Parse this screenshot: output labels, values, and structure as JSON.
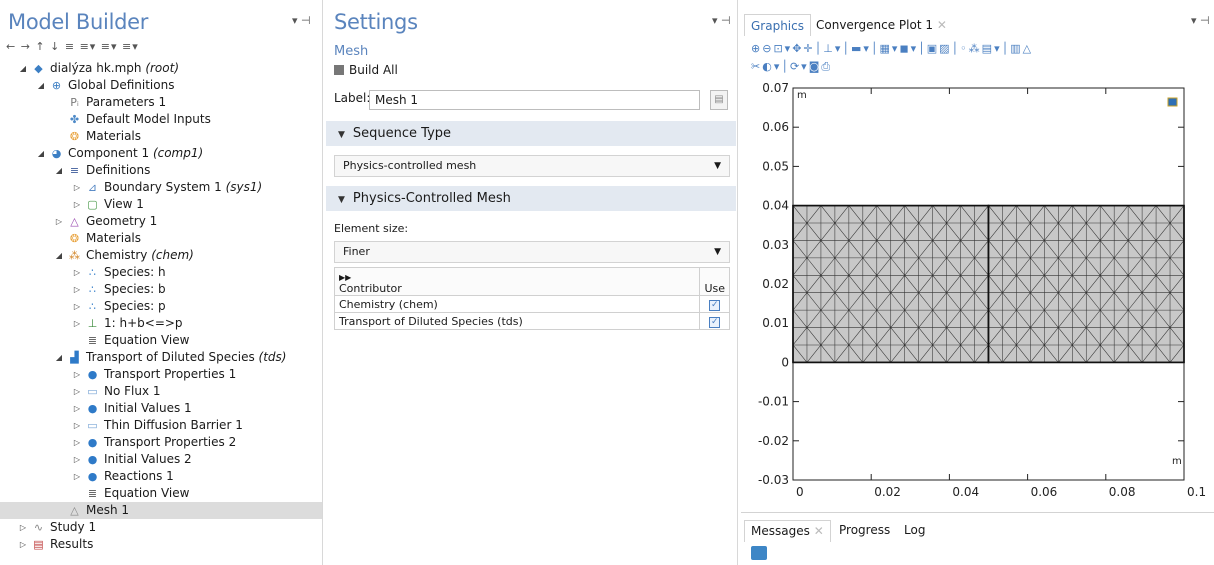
{
  "model_builder": {
    "title": "Model Builder",
    "toolbar": "← → ↑ ↓ ≡ ≡▾ ≡▾ ≡▾",
    "tree": [
      {
        "text": "dialýza hk.mph",
        "suffix": "(root)",
        "icon": "root-icon",
        "depth": 0,
        "exp": "◢"
      },
      {
        "text": "Global Definitions",
        "suffix": "",
        "icon": "globe-icon",
        "depth": 1,
        "exp": "◢"
      },
      {
        "text": "Parameters 1",
        "suffix": "",
        "icon": "parameters-icon",
        "depth": 2,
        "exp": ""
      },
      {
        "text": "Default Model Inputs",
        "suffix": "",
        "icon": "model-inputs-icon",
        "depth": 2,
        "exp": ""
      },
      {
        "text": "Materials",
        "suffix": "",
        "icon": "materials-icon",
        "depth": 2,
        "exp": ""
      },
      {
        "text": "Component 1",
        "suffix": "(comp1)",
        "icon": "component-icon",
        "depth": 1,
        "exp": "◢"
      },
      {
        "text": "Definitions",
        "suffix": "",
        "icon": "definitions-icon",
        "depth": 2,
        "exp": "◢"
      },
      {
        "text": "Boundary System 1",
        "suffix": "(sys1)",
        "icon": "boundary-system-icon",
        "depth": 3,
        "exp": "▷"
      },
      {
        "text": "View 1",
        "suffix": "",
        "icon": "view-icon",
        "depth": 3,
        "exp": "▷"
      },
      {
        "text": "Geometry 1",
        "suffix": "",
        "icon": "geometry-icon",
        "depth": 2,
        "exp": "▷"
      },
      {
        "text": "Materials",
        "suffix": "",
        "icon": "materials-icon",
        "depth": 2,
        "exp": ""
      },
      {
        "text": "Chemistry",
        "suffix": "(chem)",
        "icon": "chemistry-icon",
        "depth": 2,
        "exp": "◢"
      },
      {
        "text": "Species: h",
        "suffix": "",
        "icon": "species-icon",
        "depth": 3,
        "exp": "▷"
      },
      {
        "text": "Species: b",
        "suffix": "",
        "icon": "species-icon",
        "depth": 3,
        "exp": "▷"
      },
      {
        "text": "Species: p",
        "suffix": "",
        "icon": "species-icon",
        "depth": 3,
        "exp": "▷"
      },
      {
        "text": "1: h+b<=>p",
        "suffix": "",
        "icon": "reaction-icon",
        "depth": 3,
        "exp": "▷"
      },
      {
        "text": "Equation View",
        "suffix": "",
        "icon": "equation-view-icon",
        "depth": 3,
        "exp": ""
      },
      {
        "text": "Transport of Diluted Species",
        "suffix": "(tds)",
        "icon": "transport-icon",
        "depth": 2,
        "exp": "◢"
      },
      {
        "text": "Transport Properties 1",
        "suffix": "",
        "icon": "transport-properties-icon",
        "depth": 3,
        "exp": "▷"
      },
      {
        "text": "No Flux 1",
        "suffix": "",
        "icon": "no-flux-icon",
        "depth": 3,
        "exp": "▷"
      },
      {
        "text": "Initial Values 1",
        "suffix": "",
        "icon": "initial-values-icon",
        "depth": 3,
        "exp": "▷"
      },
      {
        "text": "Thin Diffusion Barrier 1",
        "suffix": "",
        "icon": "thin-barrier-icon",
        "depth": 3,
        "exp": "▷"
      },
      {
        "text": "Transport Properties 2",
        "suffix": "",
        "icon": "transport-properties-icon",
        "depth": 3,
        "exp": "▷"
      },
      {
        "text": "Initial Values 2",
        "suffix": "",
        "icon": "initial-values-icon",
        "depth": 3,
        "exp": "▷"
      },
      {
        "text": "Reactions 1",
        "suffix": "",
        "icon": "reactions-icon",
        "depth": 3,
        "exp": "▷"
      },
      {
        "text": "Equation View",
        "suffix": "",
        "icon": "equation-view-icon",
        "depth": 3,
        "exp": ""
      },
      {
        "text": "Mesh 1",
        "suffix": "",
        "icon": "mesh-icon",
        "depth": 2,
        "exp": "",
        "selected": true
      },
      {
        "text": "Study 1",
        "suffix": "",
        "icon": "study-icon",
        "depth": 0,
        "exp": "▷"
      },
      {
        "text": "Results",
        "suffix": "",
        "icon": "results-icon",
        "depth": 0,
        "exp": "▷"
      }
    ]
  },
  "settings": {
    "title": "Settings",
    "subtitle": "Mesh",
    "build_all": "Build All",
    "label_caption": "Label:",
    "label_value": "Mesh 1",
    "section_sequence": "Sequence Type",
    "sequence_value": "Physics-controlled mesh",
    "section_physics": "Physics-Controlled Mesh",
    "element_size_caption": "Element size:",
    "element_size_value": "Finer",
    "table": {
      "col_contributor": "Contributor",
      "col_use": "Use",
      "rows": [
        {
          "contributor": "Chemistry (chem)",
          "use": "☑"
        },
        {
          "contributor": "Transport of Diluted Species (tds)",
          "use": "☑"
        }
      ]
    }
  },
  "graphics": {
    "tab_graphics": "Graphics",
    "tab_convergence": "Convergence Plot 1",
    "axis_unit": "m",
    "messages_tab": "Messages",
    "progress_tab": "Progress",
    "log_tab": "Log",
    "mesh_color": "#c8c8c8"
  },
  "chart_data": {
    "type": "mesh-plot",
    "x_ticks": [
      "0",
      "0.02",
      "0.04",
      "0.06",
      "0.08",
      "0.1"
    ],
    "y_ticks": [
      "0.07",
      "0.06",
      "0.05",
      "0.04",
      "0.03",
      "0.02",
      "0.01",
      "0",
      "-0.01",
      "-0.02",
      "-0.03"
    ],
    "xlim": [
      0,
      0.1
    ],
    "ylim": [
      -0.03,
      0.07
    ],
    "geometry": [
      {
        "x0": 0,
        "x1": 0.05,
        "y0": 0,
        "y1": 0.04
      },
      {
        "x0": 0.05,
        "x1": 0.1,
        "y0": 0,
        "y1": 0.04
      }
    ],
    "xlabel": "m",
    "ylabel": "m"
  }
}
